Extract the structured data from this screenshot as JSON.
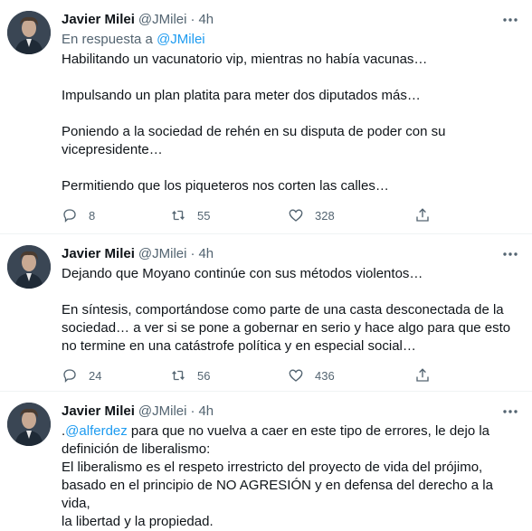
{
  "tweets": [
    {
      "author": "Javier Milei",
      "handle": "@JMilei",
      "separator": "·",
      "time": "4h",
      "reply_prefix": "En respuesta a",
      "reply_mention": "@JMilei",
      "text": "Habilitando un vacunatorio vip, mientras no había vacunas…\n\nImpulsando un plan platita para meter dos diputados más…\n\nPoniendo a la sociedad de rehén en su disputa de poder con su\nvicepresidente…\n\nPermitiendo que los piqueteros nos corten las calles…",
      "replies": "8",
      "retweets": "55",
      "likes": "328"
    },
    {
      "author": "Javier Milei",
      "handle": "@JMilei",
      "separator": "·",
      "time": "4h",
      "text": "Dejando que Moyano continúe con sus métodos violentos…\n\nEn síntesis, comportándose como parte de una casta desconectada de la\nsociedad… a ver si se pone a gobernar en serio y hace algo para que esto\nno termine en una catástrofe política y en especial social…",
      "replies": "24",
      "retweets": "56",
      "likes": "436"
    },
    {
      "author": "Javier Milei",
      "handle": "@JMilei",
      "separator": "·",
      "time": "4h",
      "text_prefix": ".",
      "text_mention": "@alferdez",
      "text_rest": " para que no vuelva a caer en este tipo de errores, le dejo la\ndefinición de liberalismo:\nEl liberalismo es el respeto irrestricto del proyecto de vida del prójimo,\nbasado en el principio de NO AGRESIÓN y en defensa del derecho a la vida,\nla libertad y la propiedad."
    }
  ],
  "icons": {
    "more": "more-icon",
    "reply": "reply-icon",
    "retweet": "retweet-icon",
    "like": "heart-icon",
    "share": "share-icon"
  },
  "colors": {
    "link": "#1d9bf0",
    "secondary": "#536471",
    "text": "#0f1419"
  }
}
